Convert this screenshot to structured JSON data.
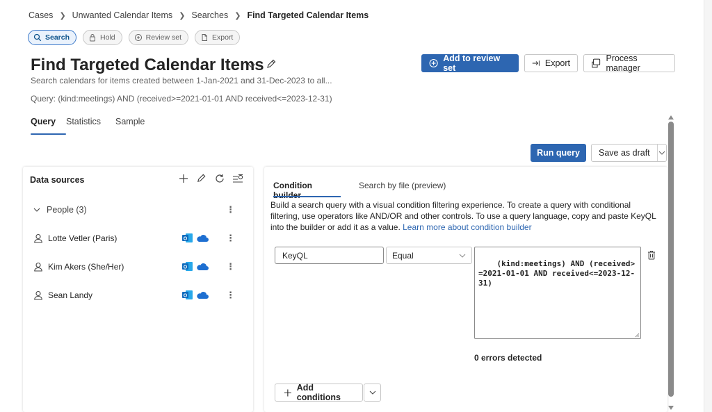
{
  "breadcrumb": {
    "items": [
      "Cases",
      "Unwanted Calendar Items",
      "Searches"
    ],
    "current": "Find Targeted Calendar Items"
  },
  "pills": {
    "search": "Search",
    "hold": "Hold",
    "review_set": "Review set",
    "export": "Export"
  },
  "header": {
    "title": "Find Targeted Calendar Items",
    "subtitle": "Search calendars for items created between 1-Jan-2021 and 31-Dec-2023 to all...",
    "query": "Query: (kind:meetings) AND (received>=2021-01-01 AND received<=2023-12-31)",
    "add_to_review_set": "Add to review set",
    "export": "Export",
    "process_manager": "Process manager"
  },
  "tabs": [
    "Query",
    "Statistics",
    "Sample"
  ],
  "actions": {
    "run_query": "Run query",
    "save_as_draft": "Save as draft"
  },
  "data_sources": {
    "title": "Data sources",
    "group_label": "People (3)",
    "people": [
      "Lotte Vetler (Paris)",
      "Kim Akers (She/Her)",
      "Sean Landy"
    ]
  },
  "condition_builder": {
    "tabs": [
      "Condition builder",
      "Search by file (preview)"
    ],
    "description": "Build a search query with a visual condition filtering experience. To create a query with conditional filtering, use operators like AND/OR and other controls. To use a query language, copy and paste KeyQL into the builder or add it as a value. ",
    "learn_more": "Learn more about condition builder",
    "field": "KeyQL",
    "operator": "Equal",
    "value": "(kind:meetings) AND (received>=2021-01-01 AND received<=2023-12-31)",
    "errors": "0 errors detected",
    "add_conditions": "Add conditions"
  },
  "colors": {
    "accent": "#2d66b1",
    "outlook": "#0f6cbd",
    "onedrive": "#1e6fd1"
  }
}
